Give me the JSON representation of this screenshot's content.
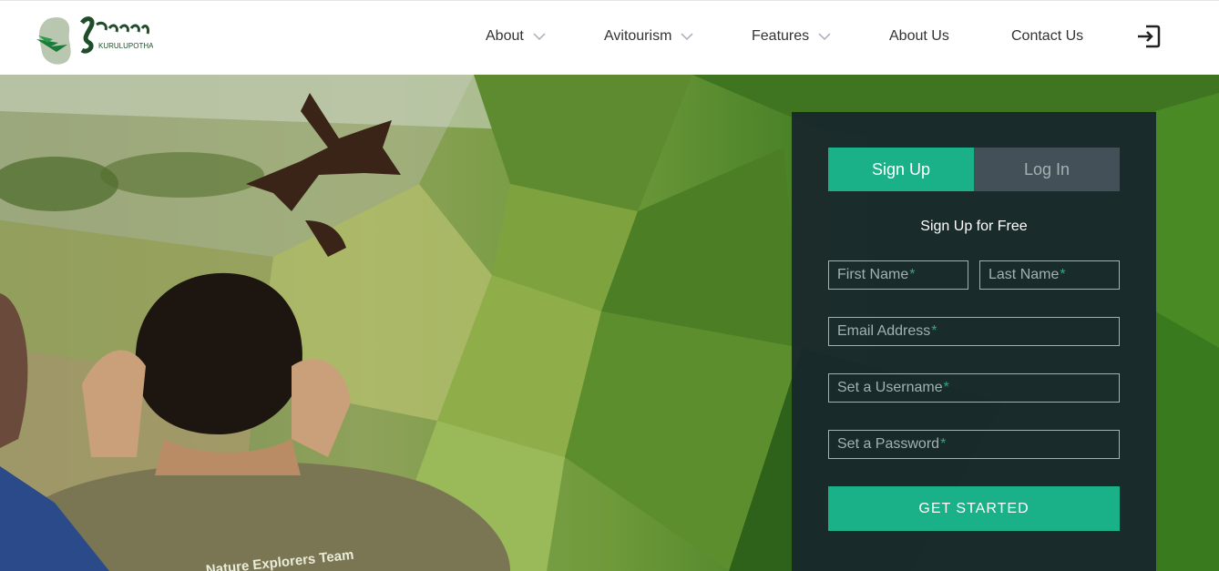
{
  "brand": {
    "logo_text": "KURULUPOTHA",
    "logo_icon": "bird-on-island-logo"
  },
  "nav": {
    "items": [
      {
        "label": "About",
        "has_dropdown": true
      },
      {
        "label": "Avitourism",
        "has_dropdown": true
      },
      {
        "label": "Features",
        "has_dropdown": true
      },
      {
        "label": "About Us",
        "has_dropdown": false
      },
      {
        "label": "Contact Us",
        "has_dropdown": false
      }
    ],
    "login_icon": "sign-in-icon"
  },
  "hero": {
    "shirt_text": "Nature Explorers Team"
  },
  "form": {
    "tabs": [
      {
        "label": "Sign Up",
        "active": true
      },
      {
        "label": "Log In",
        "active": false
      }
    ],
    "title": "Sign Up for Free",
    "fields": {
      "first_name": {
        "placeholder": "First Name",
        "required_mark": "*"
      },
      "last_name": {
        "placeholder": "Last Name",
        "required_mark": "*"
      },
      "email": {
        "placeholder": "Email Address",
        "required_mark": "*"
      },
      "username": {
        "placeholder": "Set a Username",
        "required_mark": "*"
      },
      "password": {
        "placeholder": "Set a Password",
        "required_mark": "*"
      }
    },
    "submit_label": "GET STARTED"
  },
  "colors": {
    "accent": "#1ab188",
    "panel_bg": "#18262c",
    "field_border": "#a0b3b0",
    "inactive_tab": "#435058"
  }
}
